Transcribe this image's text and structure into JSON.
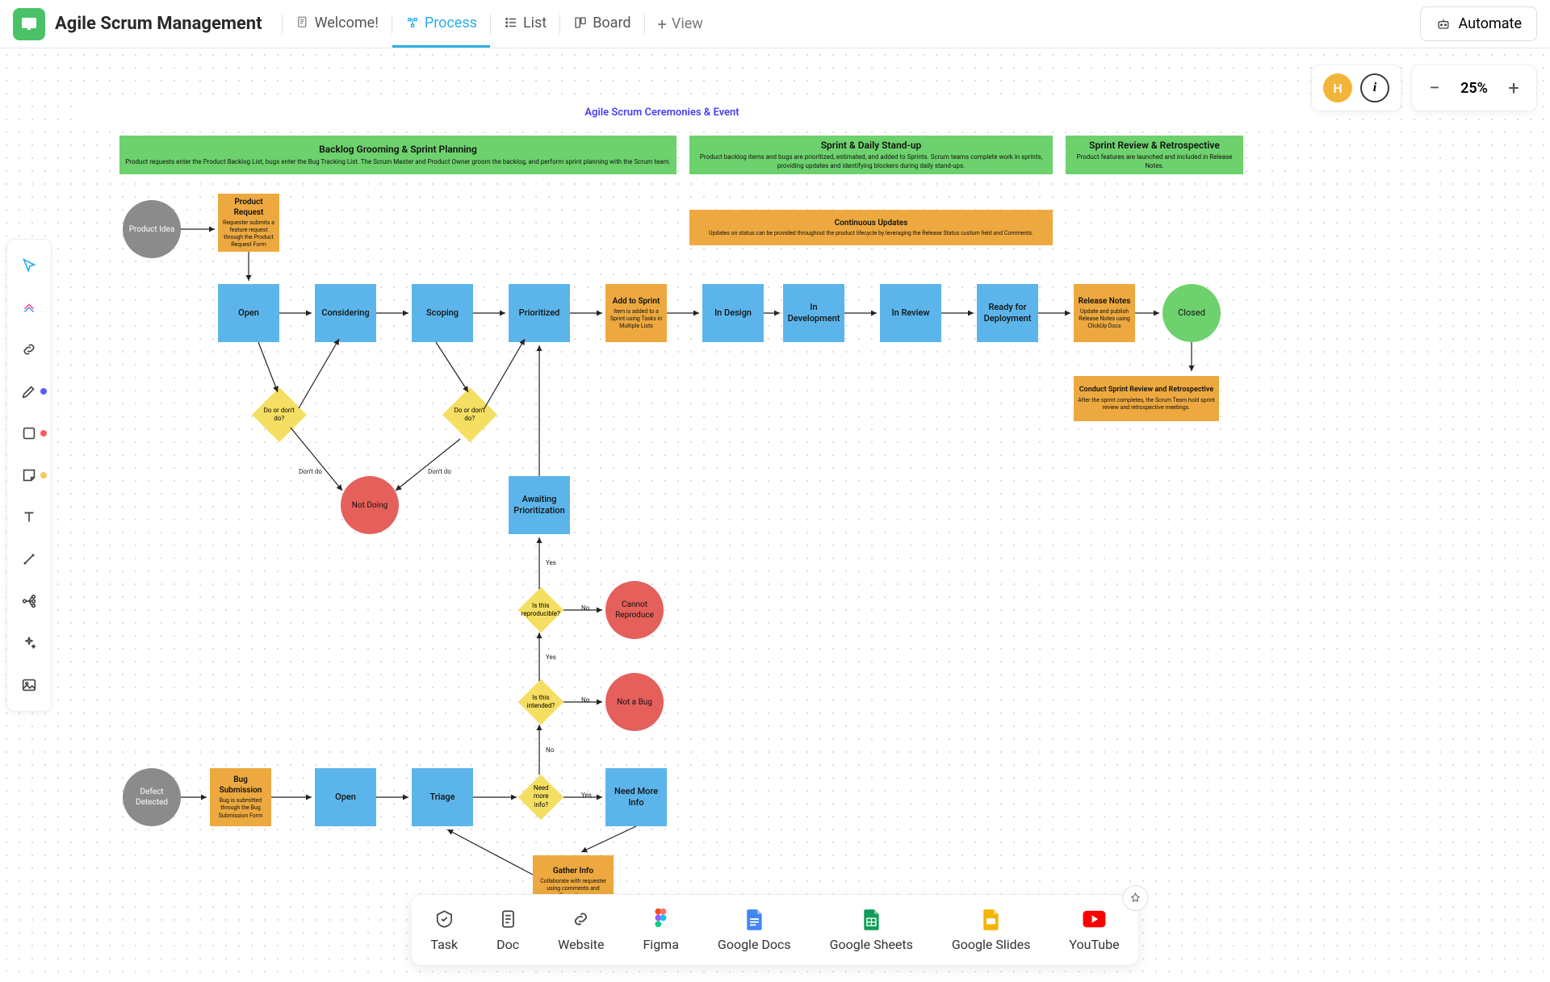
{
  "header": {
    "title": "Agile Scrum Management",
    "tabs": [
      {
        "label": "Welcome!",
        "icon": "doc"
      },
      {
        "label": "Process",
        "icon": "process",
        "active": true
      },
      {
        "label": "List",
        "icon": "list"
      },
      {
        "label": "Board",
        "icon": "board"
      }
    ],
    "add_view": "View",
    "automate": "Automate"
  },
  "zoom": {
    "value": "25%"
  },
  "avatar": {
    "initial": "H"
  },
  "diagram": {
    "title": "Agile Scrum Ceremonies & Event",
    "headers": [
      {
        "title": "Backlog Grooming & Sprint Planning",
        "sub": "Product requests enter the Product Backlog List, bugs enter the Bug Tracking List.\nThe Scrum Master and Product Owner groom the backlog, and perform sprint planning with the Scrum team."
      },
      {
        "title": "Sprint & Daily Stand-up",
        "sub": "Product backlog items and bugs are prioritized, estimated, and added to Sprints. Scrum teams complete work in sprints, providing updates and identifying blockers during daily stand-ups."
      },
      {
        "title": "Sprint Review & Retrospective",
        "sub": "Product features are launched and included in Release Notes."
      }
    ],
    "continuous": {
      "title": "Continuous Updates",
      "sub": "Updates on status can be provided throughout the product lifecycle by leveraging the Release Status custom field and Comments."
    },
    "nodes": {
      "product_idea": "Product Idea",
      "product_request": {
        "title": "Product Request",
        "sub": "Requester submits a feature request through the Product Request Form"
      },
      "open": "Open",
      "considering": "Considering",
      "scoping": "Scoping",
      "prioritized": "Prioritized",
      "add_sprint": {
        "title": "Add to Sprint",
        "sub": "Item is added to a Sprint using Tasks in Multiple Lists"
      },
      "in_design": "In Design",
      "in_dev": "In Development",
      "in_review": "In Review",
      "ready_deploy": "Ready for Deployment",
      "release_notes": {
        "title": "Release Notes",
        "sub": "Update and publish Release Notes using ClickUp Docs"
      },
      "closed": "Closed",
      "retro": {
        "title": "Conduct Sprint Review and Retrospective",
        "sub": "After the sprint completes, the Scrum Team hold sprint review and retrospective meetings."
      },
      "do1": "Do or don't do?",
      "do2": "Do or don't do?",
      "not_doing": "Not Doing",
      "awaiting": "Awaiting Prioritization",
      "reproducible": "Is this reproducible?",
      "cannot_reproduce": "Cannot Reproduce",
      "intended": "Is this intended?",
      "not_bug": "Not a Bug",
      "defect": "Defect Detected",
      "bug_sub": {
        "title": "Bug Submission",
        "sub": "Bug is submitted through the Bug Submission Form"
      },
      "open2": "Open",
      "triage": "Triage",
      "more_info": "Need more info?",
      "need_more": "Need More Info",
      "gather": {
        "title": "Gather Info",
        "sub": "Collaborate with requester using comments and @mentions"
      }
    },
    "edge_labels": {
      "dont_do_1": "Don't do",
      "dont_do_2": "Don't do",
      "yes": "Yes",
      "no": "No"
    }
  },
  "dock": [
    {
      "label": "Task",
      "icon": "task"
    },
    {
      "label": "Doc",
      "icon": "doc"
    },
    {
      "label": "Website",
      "icon": "link"
    },
    {
      "label": "Figma",
      "icon": "figma"
    },
    {
      "label": "Google Docs",
      "icon": "gdocs"
    },
    {
      "label": "Google Sheets",
      "icon": "gsheets"
    },
    {
      "label": "Google Slides",
      "icon": "gslides"
    },
    {
      "label": "YouTube",
      "icon": "youtube"
    }
  ]
}
